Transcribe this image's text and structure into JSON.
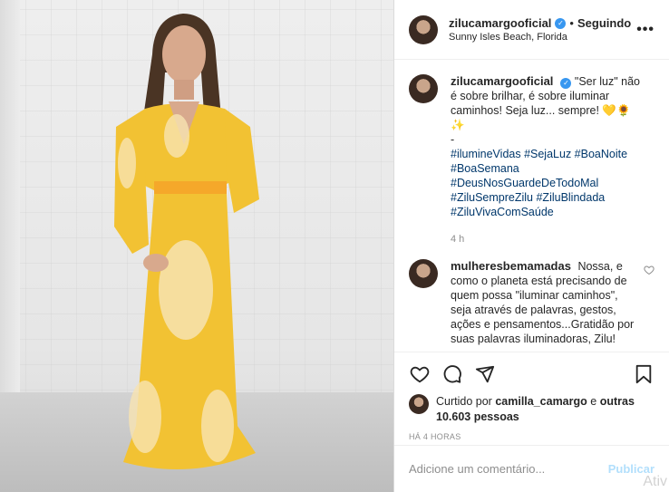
{
  "post": {
    "image_alt": "woman in long yellow dress"
  },
  "header": {
    "username": "zilucamargooficial",
    "separator": "•",
    "following_label": "Seguindo",
    "location": "Sunny Isles Beach, Florida",
    "more_icon": "more-icon"
  },
  "caption": {
    "username": "zilucamargooficial",
    "text": "\"Ser luz\" não é sobre brilhar, é sobre iluminar caminhos! Seja luz... sempre! 💛🌻✨",
    "dash": "-",
    "hashtags": [
      "#ilumineVidas #SejaLuz #BoaNoite",
      "#BoaSemana",
      "#DeusNosGuardeDeTodoMal",
      "#ZiluSempreZilu #ZiluBlindada",
      "#ZiluVivaComSaúde"
    ],
    "time": "4 h"
  },
  "comment": {
    "username": "mulheresbemamadas",
    "text": "Nossa, e como o planeta está precisando de quem possa \"iluminar caminhos\", seja através de palavras, gestos, ações e pensamentos...Gratidão por suas palavras iluminadoras, Zilu!"
  },
  "likes": {
    "prefix": "Curtido por",
    "user": "camilla_camargo",
    "middle": "e",
    "others": "outras 10.603 pessoas"
  },
  "timestamp": "HÁ 4 HORAS",
  "add_comment": {
    "placeholder": "Adicione um comentário...",
    "publish_label": "Publicar"
  },
  "watermark": "Ativ"
}
